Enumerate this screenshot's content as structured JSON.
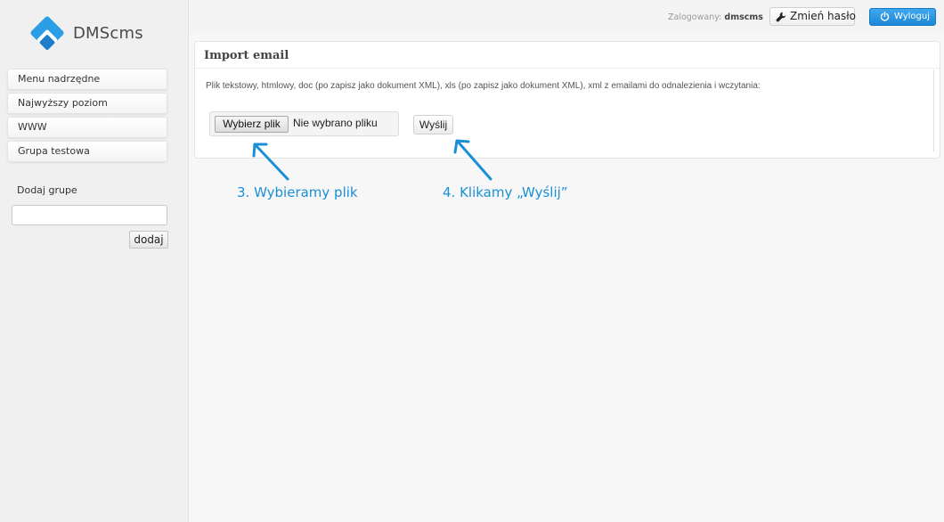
{
  "sidebar": {
    "logo_text": "DMScms",
    "items": [
      {
        "label": "Menu nadrzędne"
      },
      {
        "label": "Najwyższy poziom"
      },
      {
        "label": "WWW"
      },
      {
        "label": "Grupa testowa"
      }
    ],
    "add_group_label": "Dodaj grupe",
    "add_group_button": "dodaj"
  },
  "header": {
    "logged_label": "Zalogowany:",
    "username": "dmscms",
    "change_password": "Zmień hasło",
    "logout": "Wyloguj"
  },
  "panel": {
    "title": "Import email",
    "description": "Plik tekstowy, htmlowy, doc (po zapisz jako dokument XML), xls (po zapisz jako dokument XML), xml z emailami do odnalezienia i wczytania:",
    "file_button": "Wybierz plik",
    "file_status": "Nie wybrano pliku",
    "send_button": "Wyślij"
  },
  "annotations": {
    "step3": "3. Wybieramy plik",
    "step4": "4. Klikamy „Wyślij”"
  },
  "colors": {
    "accent_blue": "#1d88d6",
    "annotation_blue": "#1a8fd6",
    "sidebar_bg": "#f0f0f0",
    "page_bg": "#f7f7f7"
  },
  "icons": {
    "logo": "dmscms-logo-icon",
    "change_password": "wrench-icon",
    "logout": "power-icon"
  }
}
